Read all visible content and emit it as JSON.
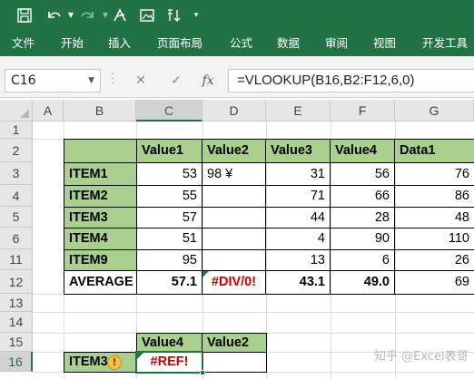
{
  "quick_access": {
    "save_icon": "save-icon",
    "undo_icon": "undo-icon",
    "redo_icon": "redo-icon",
    "touch_icon": "touch-mode-icon",
    "image_icon": "image-icon",
    "sort_icon": "sort-icon",
    "customize_icon": "customize-icon"
  },
  "ribbon_tabs": [
    "文件",
    "开始",
    "插入",
    "页面布局",
    "公式",
    "数据",
    "审阅",
    "视图",
    "开发工具"
  ],
  "formula_bar": {
    "name_box": "C16",
    "cancel_glyph": "✕",
    "enter_glyph": "✓",
    "fx_glyph": "fx",
    "formula": "=VLOOKUP(B16,B2:F12,6,0)"
  },
  "columns": [
    "A",
    "B",
    "C",
    "D",
    "E",
    "F",
    "G"
  ],
  "rows": [
    "1",
    "2",
    "3",
    "4",
    "5",
    "6",
    "11",
    "12",
    "13",
    "14",
    "15",
    "16"
  ],
  "selected_column": "C",
  "selected_row": "16",
  "table": {
    "headers": [
      "",
      "Value1",
      "Value2",
      "Value3",
      "Value4",
      "Data1"
    ],
    "rows": [
      [
        "ITEM1",
        "53",
        "98 ¥",
        "31",
        "56",
        "76"
      ],
      [
        "ITEM2",
        "55",
        "",
        "71",
        "66",
        "86"
      ],
      [
        "ITEM3",
        "57",
        "",
        "44",
        "28",
        "48"
      ],
      [
        "ITEM4",
        "51",
        "",
        "4",
        "90",
        "110"
      ],
      [
        "ITEM9",
        "95",
        "",
        "13",
        "6",
        "26"
      ]
    ],
    "average": [
      "AVERAGE",
      "57.1",
      "#DIV/0!",
      "43.1",
      "49.0",
      "69"
    ]
  },
  "lookup": {
    "headers": [
      "Value4",
      "Value2"
    ],
    "item_label": "ITEM3",
    "result_c": "#REF!",
    "result_d": "",
    "warning_glyph": "!"
  },
  "watermark": "知乎 @Excel表哥",
  "colors": {
    "brand_green": "#217346",
    "header_fill": "#a9d08e",
    "error_red": "#c00000"
  }
}
